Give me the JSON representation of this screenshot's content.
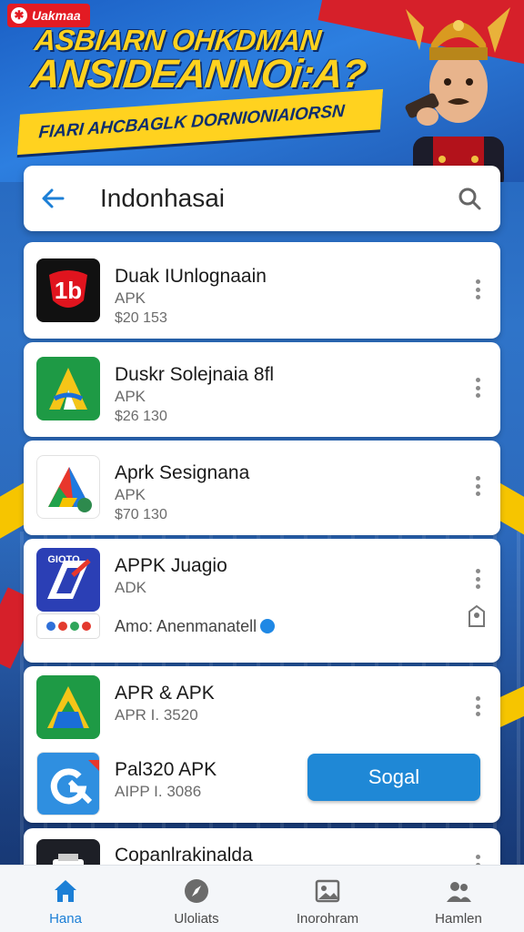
{
  "banner": {
    "brand": "Uakmaa",
    "headline_line1": "ASBIARN OHKDMAN",
    "headline_line2": "ANSIDEANNOi:A?",
    "subhead": "FIARI AHCBAGLK DORNIONIAIORSN"
  },
  "search": {
    "query": "Indonhasai"
  },
  "apps": [
    {
      "name": "Duak IUnlognaain",
      "type": "APK",
      "size": "$20 153",
      "icon": "1b-app-icon"
    },
    {
      "name": "Duskr Solejnaia 8fl",
      "type": "APK",
      "size": "$26 130",
      "icon": "green-a-app-icon"
    },
    {
      "name": "Aprk Sesignana",
      "type": "APK",
      "size": "$70 130",
      "icon": "multicolor-a-app-icon"
    },
    {
      "name": "APPK Juagio",
      "type": "ADK",
      "icon": "blue-g-app-icon",
      "promo": "Amo: Anenmanatell"
    },
    {
      "name": "APR & APK",
      "type": "APR I. 3520",
      "icon": "green-a-app-icon"
    },
    {
      "name": "Pal320 APK",
      "type": "AIPP I. 3086",
      "icon": "blue-g-arrow-app-icon",
      "action": "Sogal"
    },
    {
      "name": "Copanlrakinalda",
      "icon": "dark-box-app-icon"
    }
  ],
  "nav": [
    {
      "label": "Hana",
      "icon": "home-icon",
      "active": true
    },
    {
      "label": "Uloliats",
      "icon": "compass-icon",
      "active": false
    },
    {
      "label": "Inorohram",
      "icon": "gallery-icon",
      "active": false
    },
    {
      "label": "Hamlen",
      "icon": "people-icon",
      "active": false
    }
  ],
  "colors": {
    "accent": "#1f88d6",
    "banner_yellow": "#ffd21f",
    "banner_red": "#e31b23",
    "background_blue": "#2f74c9"
  }
}
